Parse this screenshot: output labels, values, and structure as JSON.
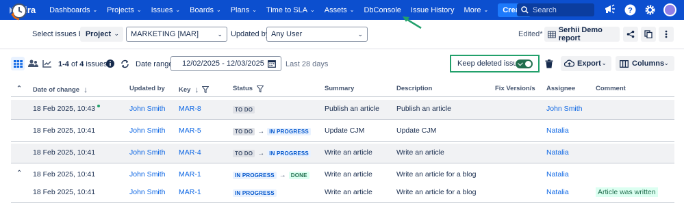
{
  "nav": {
    "logo": "Jira",
    "items": [
      {
        "label": "Dashboards",
        "dropdown": true
      },
      {
        "label": "Projects",
        "dropdown": true
      },
      {
        "label": "Issues",
        "dropdown": true
      },
      {
        "label": "Boards",
        "dropdown": true
      },
      {
        "label": "Plans",
        "dropdown": true
      },
      {
        "label": "Time to SLA",
        "dropdown": true
      },
      {
        "label": "Assets",
        "dropdown": true
      },
      {
        "label": "DbConsole",
        "dropdown": false
      },
      {
        "label": "Issue History",
        "dropdown": false
      },
      {
        "label": "More",
        "dropdown": true
      }
    ],
    "create_label": "Create",
    "search_placeholder": "Search"
  },
  "filters": {
    "select_issues_label": "Select issues by:",
    "select_issues_value": "Project",
    "project_value": "MARKETING [MAR]",
    "updated_by_label": "Updated by:",
    "updated_by_value": "Any User",
    "edited_label": "Edited*",
    "report_label": "Serhii Demo report"
  },
  "toolbar": {
    "count_bold": "1-4",
    "count_rest": " of ",
    "count_total": "4",
    "count_suffix": " issues",
    "date_range_label": "Date range:",
    "date_range_value": "12/02/2025 - 12/03/2025",
    "last_days": "Last 28 days",
    "keep_deleted_label": "Keep deleted issues",
    "keep_deleted_on": true,
    "export_label": "Export",
    "columns_label": "Columns"
  },
  "table": {
    "headers": {
      "date": "Date of change",
      "updated_by": "Updated by",
      "key": "Key",
      "status": "Status",
      "summary": "Summary",
      "description": "Description",
      "fix_version": "Fix Version/s",
      "assignee": "Assignee",
      "comment": "Comment"
    },
    "rows": [
      {
        "date": "18 Feb 2025, 10:43",
        "updated_by": "John Smith",
        "key": "MAR-8",
        "status_from": "TO DO",
        "status_to": "",
        "summary": "Publish an article",
        "description": "Publish an article",
        "assignee": "John Smith",
        "comment": ""
      },
      {
        "date": "18 Feb 2025, 10:41",
        "updated_by": "John Smith",
        "key": "MAR-5",
        "status_from": "TO DO",
        "status_to": "IN PROGRESS",
        "summary": "Update CJM",
        "description": "Update CJM",
        "assignee": "Natalia",
        "comment": ""
      },
      {
        "date": "18 Feb 2025, 10:41",
        "updated_by": "John Smith",
        "key": "MAR-4",
        "status_from": "TO DO",
        "status_to": "IN PROGRESS",
        "summary": "Write an article",
        "description": "Write an article",
        "assignee": "Natalia",
        "comment": ""
      },
      {
        "date": "18 Feb 2025, 10:41",
        "updated_by": "John Smith",
        "key": "MAR-1",
        "status_from": "IN PROGRESS",
        "status_to": "DONE",
        "summary": "Write an article",
        "description": "Write an article for a blog",
        "assignee": "Natalia",
        "comment": ""
      },
      {
        "date": "18 Feb 2025, 10:41",
        "updated_by": "John Smith",
        "key": "MAR-1",
        "status_from": "IN PROGRESS",
        "status_to": "",
        "summary": "Write an article",
        "description": "Write an article for a blog",
        "assignee": "Natalia",
        "comment": "Article was written"
      }
    ]
  },
  "colors": {
    "nav_bg": "#0c4fcf",
    "link": "#0c66e4",
    "highlight_green": "#22a06b"
  }
}
